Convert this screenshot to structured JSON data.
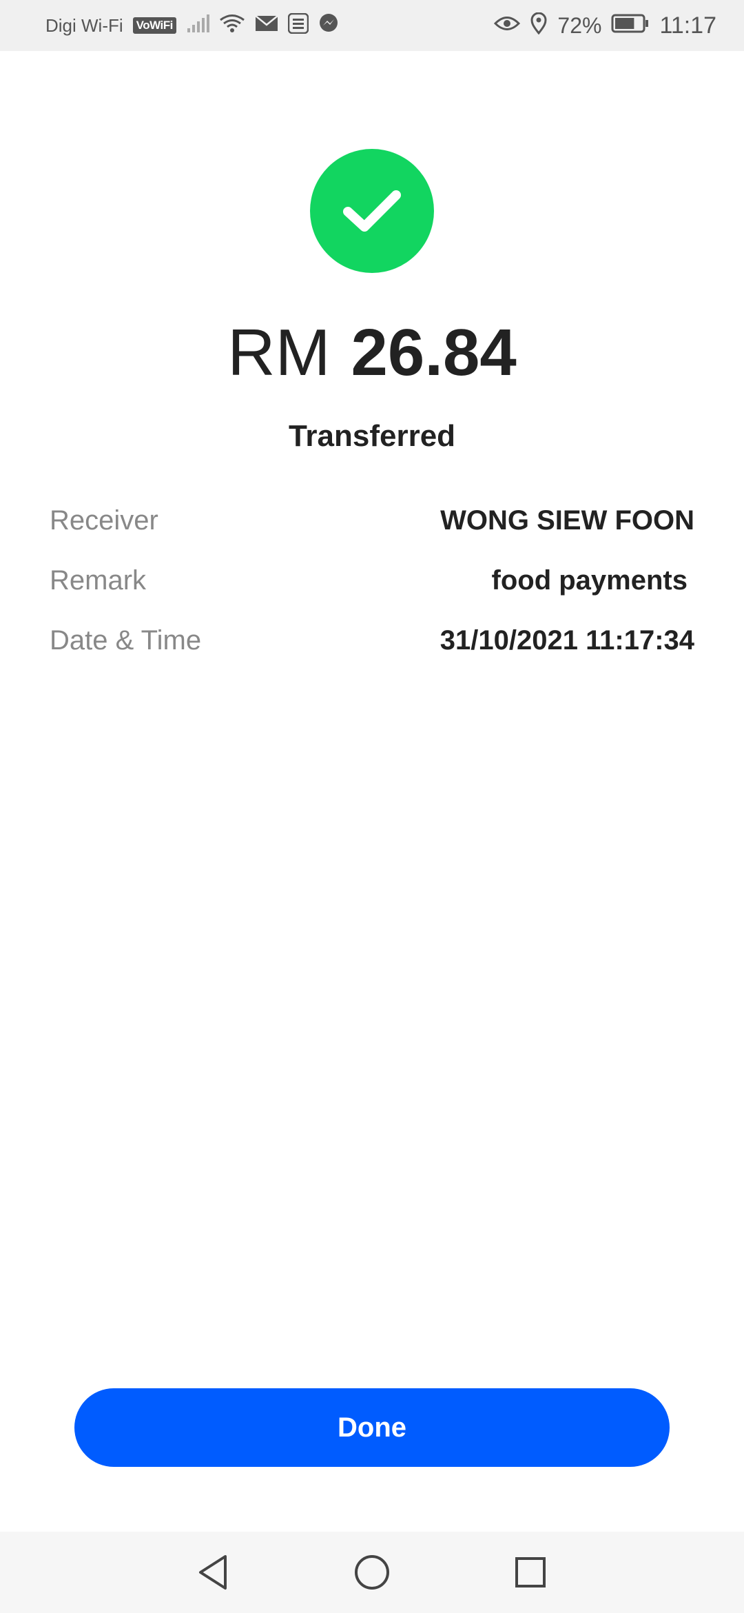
{
  "status_bar": {
    "carrier": "Digi Wi-Fi",
    "vowifi_badge": "VoWiFi",
    "battery_percent": "72%",
    "time": "11:17",
    "icons": [
      "signal-icon",
      "wifi-icon",
      "mail-icon",
      "touchngo-ewallet-icon",
      "messenger-icon",
      "eye-icon",
      "location-icon",
      "battery-icon"
    ],
    "battery_level": 0.72
  },
  "transaction": {
    "currency": "RM",
    "amount": "26.84",
    "status": "Transferred",
    "success_color": "#12d560"
  },
  "details": [
    {
      "label": "Receiver",
      "value": "WONG SIEW FOON"
    },
    {
      "label": "Remark",
      "value": "food payments"
    },
    {
      "label": "Date & Time",
      "value": "31/10/2021 11:17:34"
    }
  ],
  "actions": {
    "done_label": "Done",
    "accent": "#005cff"
  },
  "nav_bar": {
    "buttons": [
      "back-icon",
      "home-icon",
      "recents-icon"
    ]
  }
}
